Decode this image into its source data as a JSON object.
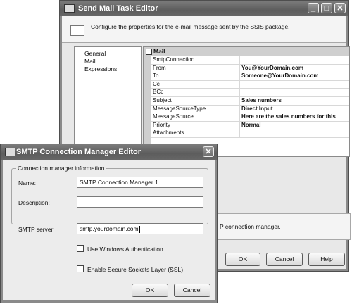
{
  "back_window": {
    "title": "Send Mail Task Editor",
    "header_text": "Configure the properties for the e-mail message sent by the SSIS package.",
    "nav_items": [
      "General",
      "Mail",
      "Expressions"
    ],
    "grid": {
      "category": "Mail",
      "category_toggle": "−",
      "rows": [
        {
          "name": "SmtpConnection",
          "value": ""
        },
        {
          "name": "From",
          "value": "You@YourDomain.com"
        },
        {
          "name": "To",
          "value": "Someone@YourDomain.com"
        },
        {
          "name": "Cc",
          "value": ""
        },
        {
          "name": "BCc",
          "value": ""
        },
        {
          "name": "Subject",
          "value": "Sales numbers"
        },
        {
          "name": "MessageSourceType",
          "value": "Direct Input"
        },
        {
          "name": "MessageSource",
          "value": "Here are the sales numbers for this"
        },
        {
          "name": "Priority",
          "value": "Normal"
        },
        {
          "name": "Attachments",
          "value": ""
        }
      ]
    },
    "description_text": "P connection manager.",
    "buttons": {
      "ok": "OK",
      "cancel": "Cancel",
      "help": "Help"
    },
    "title_buttons": {
      "minimize": "_",
      "maximize": "□",
      "close": "✕"
    }
  },
  "front_window": {
    "title": "SMTP Connection Manager Editor",
    "close_glyph": "✕",
    "group_label": "Connection manager information",
    "name_label": "Name:",
    "name_value": "SMTP Connection Manager 1",
    "description_label": "Description:",
    "description_value": "",
    "server_label": "SMTP server:",
    "server_value": "smtp.yourdomain.com",
    "checkbox_windows_auth": "Use Windows Authentication",
    "checkbox_ssl": "Enable Secure Sockets Layer (SSL)",
    "buttons": {
      "ok": "OK",
      "cancel": "Cancel"
    }
  }
}
